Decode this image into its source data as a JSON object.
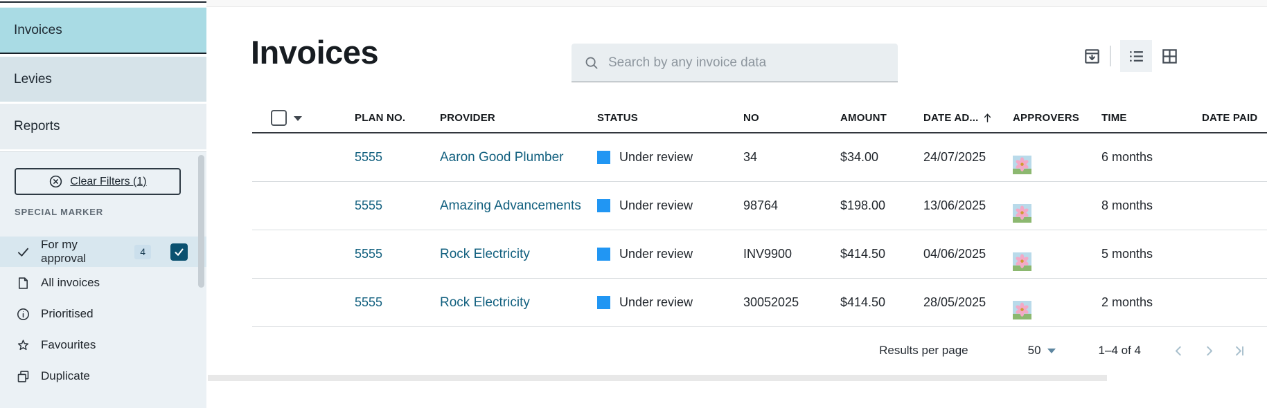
{
  "colors": {
    "accent": "#12607f",
    "status-blue": "#2196f3",
    "sidebar-active": "#a9dbe4",
    "checkbox-checked": "#0b5170",
    "collapse-btn": "#084e66"
  },
  "sidebar": {
    "nav": [
      "Invoices",
      "Levies",
      "Reports"
    ],
    "clear_filters_label": "Clear Filters (1)",
    "section_label": "SPECIAL MARKER",
    "filters": [
      {
        "label": "For my approval",
        "icon": "check-icon",
        "badge": "4",
        "checked": true
      },
      {
        "label": "All invoices",
        "icon": "document-icon"
      },
      {
        "label": "Prioritised",
        "icon": "info-icon"
      },
      {
        "label": "Favourites",
        "icon": "star-icon"
      },
      {
        "label": "Duplicate",
        "icon": "duplicate-icon"
      }
    ]
  },
  "header": {
    "title": "Invoices",
    "search_placeholder": "Search by any invoice data"
  },
  "table": {
    "headers": {
      "plan_no": "PLAN NO.",
      "provider": "PROVIDER",
      "status": "STATUS",
      "no": "NO",
      "amount": "AMOUNT",
      "date_added": "DATE AD...",
      "approvers": "APPROVERS",
      "time": "TIME",
      "date_paid": "DATE PAID"
    },
    "sort_column": "DATE AD...",
    "sort_direction": "asc",
    "rows": [
      {
        "plan_no": "5555",
        "provider": "Aaron Good Plumber",
        "status": "Under review",
        "no": "34",
        "amount": "$34.00",
        "date_added": "24/07/2025",
        "time": "6 months",
        "date_paid": ""
      },
      {
        "plan_no": "5555",
        "provider": "Amazing Advancements",
        "status": "Under review",
        "no": "98764",
        "amount": "$198.00",
        "date_added": "13/06/2025",
        "time": "8 months",
        "date_paid": ""
      },
      {
        "plan_no": "5555",
        "provider": "Rock Electricity",
        "status": "Under review",
        "no": "INV9900",
        "amount": "$414.50",
        "date_added": "04/06/2025",
        "time": "5 months",
        "date_paid": ""
      },
      {
        "plan_no": "5555",
        "provider": "Rock Electricity",
        "status": "Under review",
        "no": "30052025",
        "amount": "$414.50",
        "date_added": "28/05/2025",
        "time": "2 months",
        "date_paid": ""
      }
    ]
  },
  "footer": {
    "results_label": "Results per page",
    "page_size": "50",
    "range": "1–4 of 4"
  }
}
